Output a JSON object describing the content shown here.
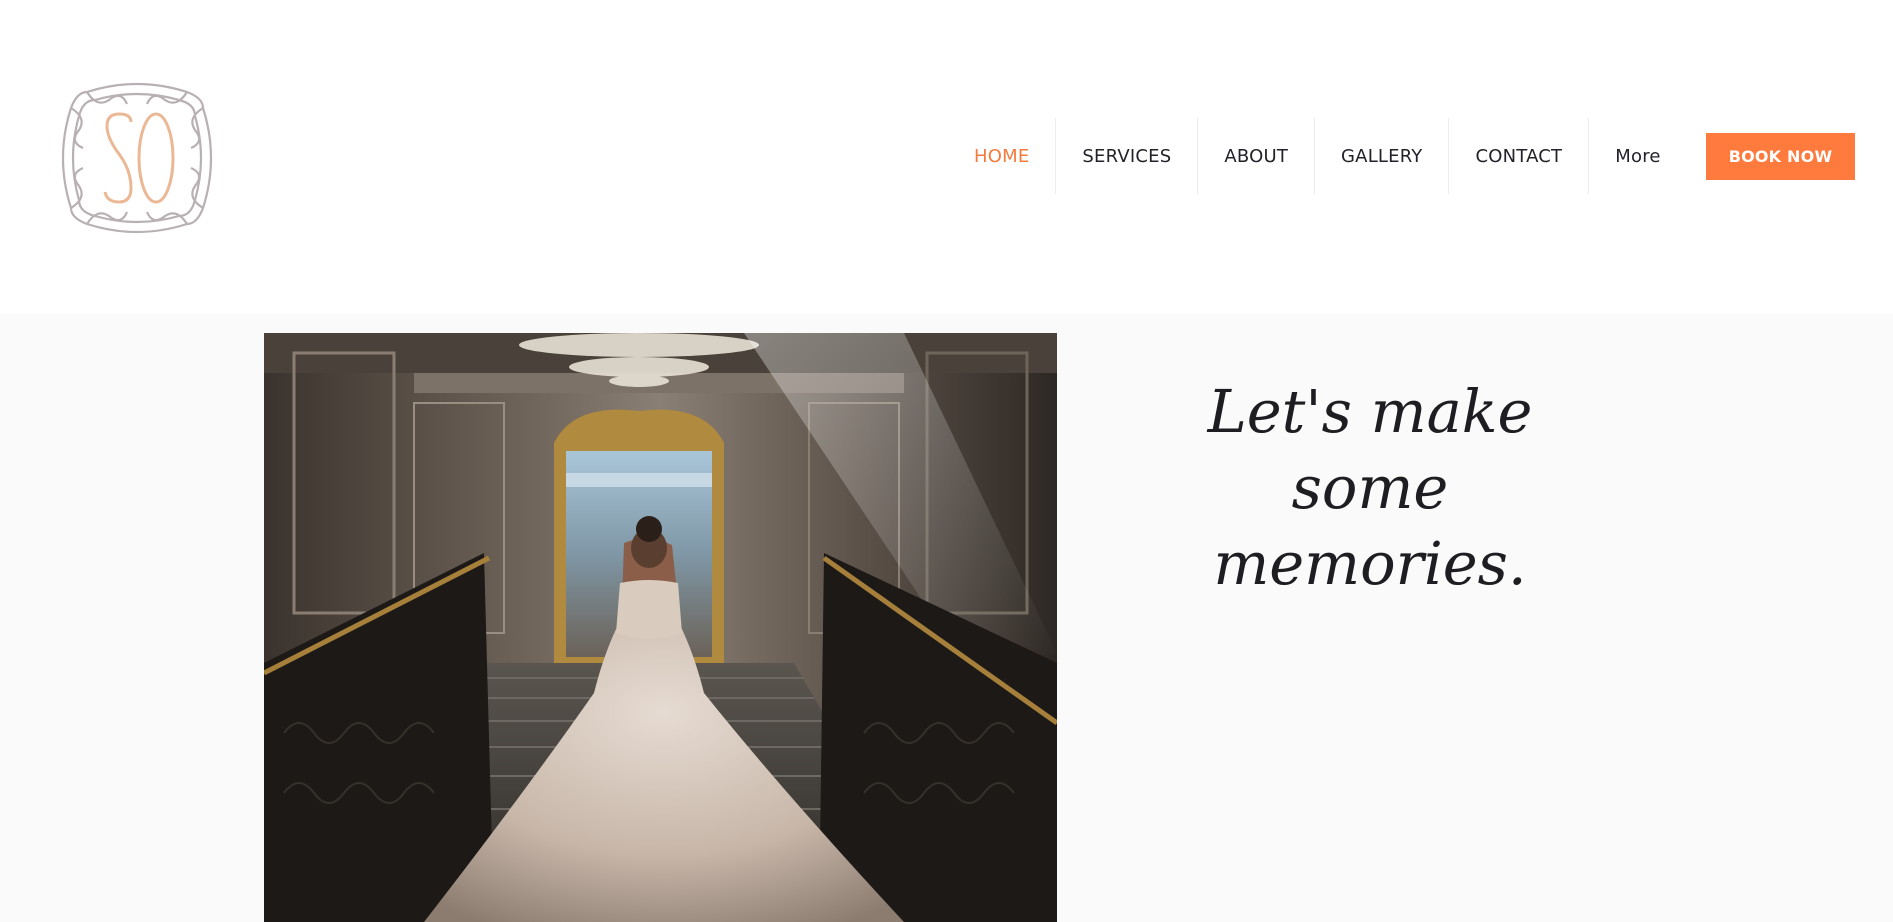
{
  "brand": {
    "logo_letters": "SO",
    "logo_letter_color": "#ebb896",
    "logo_frame_color": "#b8b0b4"
  },
  "nav": {
    "items": [
      {
        "label": "HOME",
        "active": true
      },
      {
        "label": "SERVICES",
        "active": false
      },
      {
        "label": "ABOUT",
        "active": false
      },
      {
        "label": "GALLERY",
        "active": false
      },
      {
        "label": "CONTACT",
        "active": false
      },
      {
        "label": "More",
        "active": false
      }
    ],
    "active_color": "#f47b3e"
  },
  "cta": {
    "book_now_label": "BOOK NOW",
    "color": "#ff7a3d"
  },
  "hero": {
    "tagline_line1": "Let's make",
    "tagline_line2": "some",
    "tagline_line3": "memories.",
    "image_subject": "bride-on-staircase-photo"
  }
}
